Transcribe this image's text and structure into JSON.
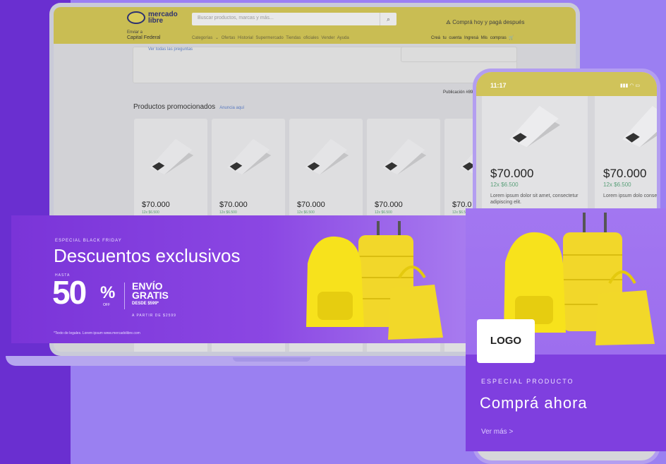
{
  "header": {
    "logo_text": "mercado libre",
    "search_placeholder": "Buscar productos, marcas y más...",
    "promo": "Comprá hoy y pagá después",
    "location_label": "Enviar a",
    "location_value": "Capital Federal",
    "nav": "Categorías ⌄  Ofertas  Historial  Supermercado  Tiendas oficiales  Vender  Ayuda",
    "account": "Creá tu cuenta  Ingresá  Mis compras"
  },
  "page": {
    "questions_link": "Ver todas las preguntas",
    "publication": "Publicación #892",
    "section_title": "Productos promocionados",
    "section_link": "Anuncia aquí"
  },
  "products": [
    {
      "price": "$70.000",
      "installments": "12x $6.500"
    },
    {
      "price": "$70.000",
      "installments": "12x $6.500"
    },
    {
      "price": "$70.000",
      "installments": "12x $6.500"
    },
    {
      "price": "$70.000",
      "installments": "12x $6.500"
    },
    {
      "price": "$70.0",
      "installments": "12x $6.5"
    }
  ],
  "banner": {
    "eyebrow": "ESPECIAL BLACK FRIDAY",
    "title": "Descuentos exclusivos",
    "hasta": "HASTA",
    "discount": "50",
    "percent": "%",
    "off": "OFF",
    "envio": "ENVÍO",
    "gratis": "GRATIS",
    "desde": "DESDE $599*",
    "partir": "A PARTIR DE $2599",
    "legal": "*Texto de legales. Lorem ipsum www.mercadolibre.com"
  },
  "phone": {
    "time": "11:17",
    "status_icons": "▮▮▮ ◠ ▭",
    "cards": [
      {
        "price": "$70.000",
        "installments": "12x $6.500",
        "desc": "Lorem ipsum dolor sit amet, consectetur adipiscing elit."
      },
      {
        "price": "$70.000",
        "installments": "12x $6.500",
        "desc": "Lorem ipsum dolo consectetur adipi"
      }
    ]
  },
  "promo_card": {
    "logo": "LOGO",
    "eyebrow": "ESPECIAL PRODUCTO",
    "title": "Comprá ahora",
    "link": "Ver más >"
  },
  "colors": {
    "background": "#6a2fd0",
    "accent": "#9b7ff2",
    "header_yellow": "#c9bd53",
    "banner_purple": "#7a34d8",
    "product_yellow": "#f7e21c"
  }
}
